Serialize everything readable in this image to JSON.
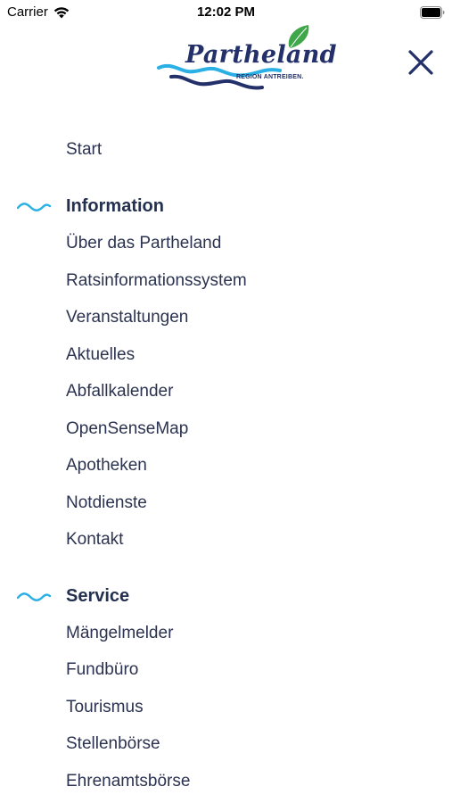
{
  "status_bar": {
    "carrier": "Carrier",
    "time": "12:02 PM"
  },
  "header": {
    "logo_text": "Partheland",
    "logo_tagline": "REGION ANTREIBEN.",
    "brand_navy": "#23306a",
    "brand_blue": "#2ab0e4",
    "brand_green": "#3fa64a"
  },
  "menu": {
    "start": "Start",
    "sections": [
      {
        "title": "Information",
        "items": [
          "Über das Partheland",
          "Ratsinformationssystem",
          "Veranstaltungen",
          "Aktuelles",
          "Abfallkalender",
          "OpenSenseMap",
          "Apotheken",
          "Notdienste",
          "Kontakt"
        ]
      },
      {
        "title": "Service",
        "items": [
          "Mängelmelder",
          "Fundbüro",
          "Tourismus",
          "Stellenbörse",
          "Ehrenamtsbörse"
        ]
      }
    ]
  }
}
